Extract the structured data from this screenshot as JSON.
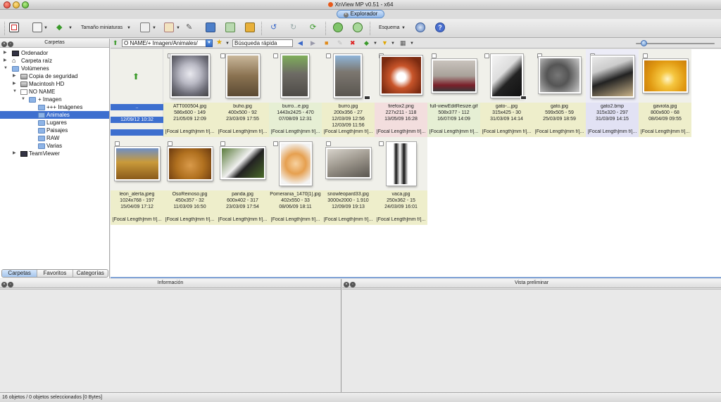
{
  "window": {
    "title": "XnView MP v0.51 - x64",
    "tab_label": "Explorador"
  },
  "toolbar": {
    "thumb_size_label": "Tamaño miniaturas",
    "layout_label": "Esquema"
  },
  "folders_panel": {
    "title": "Carpetas",
    "tree": [
      {
        "label": "Ordenador",
        "icon": "computer-icon"
      },
      {
        "label": "Carpeta raíz",
        "icon": "home-icon"
      },
      {
        "label": "Volúmenes",
        "icon": "folder-icon"
      },
      {
        "label": "Copia de seguridad",
        "icon": "hard-drive-icon"
      },
      {
        "label": "Macintosh HD",
        "icon": "hard-drive-icon"
      },
      {
        "label": "NO NAME",
        "icon": "drive-icon"
      },
      {
        "label": "+ Imagen",
        "icon": "folder-icon"
      },
      {
        "label": "+++ Imágenes",
        "icon": "folder-icon"
      },
      {
        "label": "Animales",
        "icon": "folder-icon"
      },
      {
        "label": "Lugares",
        "icon": "folder-icon"
      },
      {
        "label": "Paisajes",
        "icon": "folder-icon"
      },
      {
        "label": "RAW",
        "icon": "folder-icon"
      },
      {
        "label": "Varias",
        "icon": "folder-icon"
      },
      {
        "label": "TeamViewer",
        "icon": "computer-icon"
      }
    ],
    "tabs": [
      "Carpetas",
      "Favoritos",
      "Categorías"
    ]
  },
  "address_bar": {
    "path": "O NAME/+ Imagen/Animales/",
    "search_value": "Búsqueda rápida"
  },
  "parent_entry": {
    "name": "..",
    "date": "12/09/12 10:32"
  },
  "files": [
    {
      "name": "ATT000504.jpg",
      "dims": "586x600 - 149",
      "date": "21/05/09 12:09",
      "meta": "[Focal Length]mm f/[..."
    },
    {
      "name": "buho.jpg",
      "dims": "400x500 - 92",
      "date": "23/03/09 17:55",
      "meta": "[Focal Length]mm f/[..."
    },
    {
      "name": "burro...e.jpg",
      "dims": "1443x2425 - 470",
      "date": "07/08/09 12:31",
      "meta": "[Focal Length]mm f/[..."
    },
    {
      "name": "burro.jpg",
      "dims": "200x356 - 27",
      "date": "12/03/09 12:56",
      "date2": "12/03/09 11:56",
      "meta": "[Focal Length]mm f/[..."
    },
    {
      "name": "firefox2.png",
      "dims": "227x211 - 118",
      "date": "13/05/09 16:28",
      "meta": "[Focal Length]mm f/[..."
    },
    {
      "name": "full-viewEditResize.gif",
      "dims": "508x377 - 112",
      "date": "16/07/09 14:09",
      "meta": "[Focal Length]mm f/[..."
    },
    {
      "name": "gato-...jpg",
      "dims": "315x425 - 30",
      "date": "31/03/09 14:14",
      "meta": "[Focal Length]mm f/[..."
    },
    {
      "name": "gato.jpg",
      "dims": "599x505 - 59",
      "date": "25/03/09 18:59",
      "meta": "[Focal Length]mm f/[..."
    },
    {
      "name": "gato2.bmp",
      "dims": "315x320 - 297",
      "date": "31/03/09 14:15",
      "meta": "[Focal Length]mm f/[..."
    },
    {
      "name": "gaviota.jpg",
      "dims": "800x600 - 68",
      "date": "08/04/09 09:55",
      "meta": "[Focal Length]mm f/[..."
    },
    {
      "name": "leon_alerta.jpeg",
      "dims": "1024x768 - 197",
      "date": "15/04/09 17:12",
      "meta": "[Focal Length]mm f/[..."
    },
    {
      "name": "OsoReinoso.jpg",
      "dims": "450x357 - 32",
      "date": "11/03/09 16:50",
      "meta": "[Focal Length]mm f/[..."
    },
    {
      "name": "panda.jpg",
      "dims": "600x402 - 317",
      "date": "23/03/09 17:54",
      "meta": "[Focal Length]mm f/[..."
    },
    {
      "name": "Pomerania_1470[1].jpg",
      "dims": "402x550 - 33",
      "date": "08/06/09 18:11",
      "meta": "[Focal Length]mm f/[..."
    },
    {
      "name": "snowleopard33.jpg",
      "dims": "3000x2000 - 1.910",
      "date": "12/09/09 19:13",
      "meta": "[Focal Length]mm f/[..."
    },
    {
      "name": "vaca.jpg",
      "dims": "250x362 - 15",
      "date": "24/03/09 16:01",
      "meta": "[Focal Length]mm f/[..."
    }
  ],
  "info_panel": {
    "title": "Información"
  },
  "preview_panel": {
    "title": "Vista preliminar"
  },
  "status": {
    "text": "16 objetos / 0 objetos seleccionados [0 Bytes]"
  },
  "colors": {
    "selection": "#3d6fcf",
    "accent": "#7da0d4"
  }
}
